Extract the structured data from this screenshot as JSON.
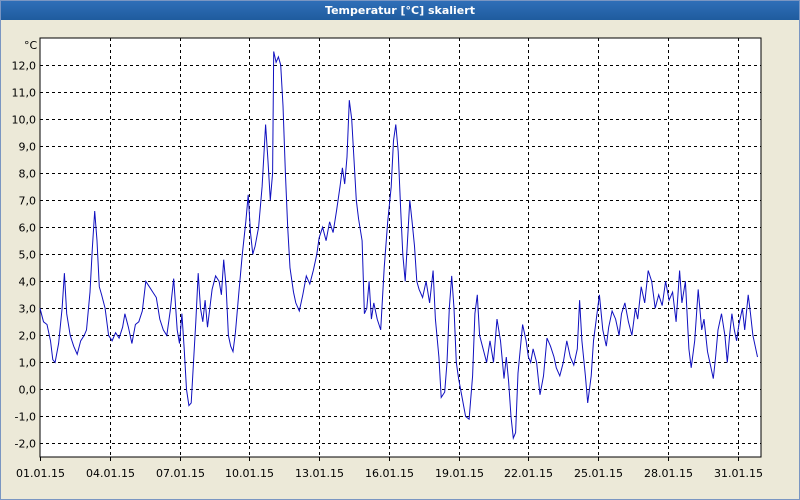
{
  "window": {
    "title": "Temperatur [°C] skaliert"
  },
  "colors": {
    "line": "#1010c0",
    "plot_bg": "#ffffff",
    "title_bar": "#1f5c9e",
    "window_bg": "#ece9d8"
  },
  "chart_data": {
    "type": "line",
    "title": "Temperatur [°C] skaliert",
    "ylabel": "°C",
    "xlabel": "",
    "ylim": [
      -2.5,
      13.0
    ],
    "xlim": [
      "2015-01-01",
      "2015-02-01"
    ],
    "grid": true,
    "y_ticks": [
      -2.0,
      -1.0,
      0.0,
      1.0,
      2.0,
      3.0,
      4.0,
      5.0,
      6.0,
      7.0,
      8.0,
      9.0,
      10.0,
      11.0,
      12.0
    ],
    "y_tick_labels": [
      "-2,0",
      "-1,0",
      "0,0",
      "1,0",
      "2,0",
      "3,0",
      "4,0",
      "5,0",
      "6,0",
      "7,0",
      "8,0",
      "9,0",
      "10,0",
      "11,0",
      "12,0"
    ],
    "x_tick_labels": [
      "01.01.15",
      "04.01.15",
      "07.01.15",
      "10.01.15",
      "13.01.15",
      "16.01.15",
      "19.01.15",
      "22.01.15",
      "25.01.15",
      "28.01.15",
      "31.01.15"
    ],
    "x_ticks_days": [
      0,
      3,
      6,
      9,
      12,
      15,
      18,
      21,
      24,
      27,
      30
    ],
    "series": [
      {
        "points": [
          [
            0.0,
            3.0
          ],
          [
            0.15,
            2.5
          ],
          [
            0.3,
            2.4
          ],
          [
            0.45,
            1.8
          ],
          [
            0.55,
            1.1
          ],
          [
            0.65,
            1.0
          ],
          [
            0.8,
            1.7
          ],
          [
            0.95,
            3.0
          ],
          [
            1.05,
            4.3
          ],
          [
            1.15,
            2.8
          ],
          [
            1.3,
            2.0
          ],
          [
            1.45,
            1.6
          ],
          [
            1.6,
            1.3
          ],
          [
            1.75,
            1.8
          ],
          [
            1.9,
            2.0
          ],
          [
            2.0,
            2.2
          ],
          [
            2.15,
            3.6
          ],
          [
            2.25,
            5.2
          ],
          [
            2.35,
            6.6
          ],
          [
            2.45,
            5.5
          ],
          [
            2.55,
            3.8
          ],
          [
            2.65,
            3.5
          ],
          [
            2.8,
            3.0
          ],
          [
            2.95,
            2.0
          ],
          [
            3.1,
            1.8
          ],
          [
            3.25,
            2.1
          ],
          [
            3.4,
            1.9
          ],
          [
            3.55,
            2.3
          ],
          [
            3.65,
            2.8
          ],
          [
            3.8,
            2.3
          ],
          [
            3.95,
            1.7
          ],
          [
            4.1,
            2.4
          ],
          [
            4.25,
            2.5
          ],
          [
            4.4,
            2.9
          ],
          [
            4.55,
            4.0
          ],
          [
            4.7,
            3.8
          ],
          [
            4.85,
            3.6
          ],
          [
            5.0,
            3.4
          ],
          [
            5.15,
            2.6
          ],
          [
            5.3,
            2.2
          ],
          [
            5.45,
            2.0
          ],
          [
            5.6,
            2.9
          ],
          [
            5.75,
            4.1
          ],
          [
            5.9,
            2.2
          ],
          [
            6.0,
            1.7
          ],
          [
            6.1,
            2.8
          ],
          [
            6.2,
            1.5
          ],
          [
            6.3,
            0.0
          ],
          [
            6.4,
            -0.6
          ],
          [
            6.5,
            -0.5
          ],
          [
            6.6,
            1.0
          ],
          [
            6.7,
            2.5
          ],
          [
            6.8,
            4.3
          ],
          [
            6.9,
            3.0
          ],
          [
            7.0,
            2.5
          ],
          [
            7.1,
            3.3
          ],
          [
            7.2,
            2.3
          ],
          [
            7.3,
            3.0
          ],
          [
            7.4,
            3.7
          ],
          [
            7.55,
            4.2
          ],
          [
            7.7,
            4.0
          ],
          [
            7.8,
            3.5
          ],
          [
            7.9,
            4.8
          ],
          [
            8.0,
            3.8
          ],
          [
            8.1,
            2.0
          ],
          [
            8.2,
            1.6
          ],
          [
            8.3,
            1.4
          ],
          [
            8.4,
            2.1
          ],
          [
            8.55,
            3.6
          ],
          [
            8.7,
            5.0
          ],
          [
            8.85,
            6.2
          ],
          [
            8.95,
            7.2
          ],
          [
            9.05,
            5.8
          ],
          [
            9.15,
            5.0
          ],
          [
            9.25,
            5.3
          ],
          [
            9.4,
            6.0
          ],
          [
            9.55,
            7.5
          ],
          [
            9.7,
            9.8
          ],
          [
            9.8,
            8.5
          ],
          [
            9.9,
            7.0
          ],
          [
            10.0,
            8.0
          ],
          [
            10.05,
            12.5
          ],
          [
            10.15,
            12.1
          ],
          [
            10.25,
            12.3
          ],
          [
            10.35,
            12.0
          ],
          [
            10.45,
            10.5
          ],
          [
            10.55,
            8.0
          ],
          [
            10.65,
            6.0
          ],
          [
            10.75,
            4.5
          ],
          [
            10.9,
            3.6
          ],
          [
            11.0,
            3.2
          ],
          [
            11.15,
            2.9
          ],
          [
            11.3,
            3.5
          ],
          [
            11.45,
            4.2
          ],
          [
            11.6,
            3.9
          ],
          [
            11.75,
            4.4
          ],
          [
            11.9,
            5.0
          ],
          [
            12.0,
            5.6
          ],
          [
            12.15,
            6.0
          ],
          [
            12.3,
            5.5
          ],
          [
            12.45,
            6.2
          ],
          [
            12.6,
            5.8
          ],
          [
            12.75,
            6.6
          ],
          [
            12.9,
            7.5
          ],
          [
            13.0,
            8.2
          ],
          [
            13.1,
            7.6
          ],
          [
            13.2,
            8.6
          ],
          [
            13.3,
            10.7
          ],
          [
            13.4,
            10.0
          ],
          [
            13.5,
            8.5
          ],
          [
            13.6,
            7.0
          ],
          [
            13.7,
            6.3
          ],
          [
            13.85,
            5.5
          ],
          [
            13.95,
            2.8
          ],
          [
            14.05,
            3.0
          ],
          [
            14.15,
            4.0
          ],
          [
            14.25,
            2.6
          ],
          [
            14.35,
            3.2
          ],
          [
            14.5,
            2.6
          ],
          [
            14.65,
            2.2
          ],
          [
            14.8,
            4.5
          ],
          [
            14.95,
            6.2
          ],
          [
            15.1,
            7.5
          ],
          [
            15.2,
            9.2
          ],
          [
            15.3,
            9.8
          ],
          [
            15.4,
            8.8
          ],
          [
            15.5,
            6.8
          ],
          [
            15.6,
            5.0
          ],
          [
            15.7,
            4.0
          ],
          [
            15.8,
            5.5
          ],
          [
            15.9,
            7.0
          ],
          [
            16.0,
            6.2
          ],
          [
            16.1,
            5.3
          ],
          [
            16.2,
            4.0
          ],
          [
            16.3,
            3.7
          ],
          [
            16.45,
            3.4
          ],
          [
            16.6,
            4.0
          ],
          [
            16.75,
            3.2
          ],
          [
            16.9,
            4.4
          ],
          [
            17.0,
            2.6
          ],
          [
            17.15,
            1.2
          ],
          [
            17.25,
            -0.3
          ],
          [
            17.4,
            -0.1
          ],
          [
            17.5,
            1.0
          ],
          [
            17.6,
            3.0
          ],
          [
            17.7,
            4.2
          ],
          [
            17.8,
            3.0
          ],
          [
            17.9,
            1.0
          ],
          [
            18.0,
            0.4
          ],
          [
            18.15,
            -0.3
          ],
          [
            18.3,
            -1.0
          ],
          [
            18.45,
            -1.1
          ],
          [
            18.6,
            0.5
          ],
          [
            18.7,
            2.8
          ],
          [
            18.8,
            3.5
          ],
          [
            18.9,
            2.0
          ],
          [
            19.05,
            1.5
          ],
          [
            19.2,
            1.0
          ],
          [
            19.35,
            1.8
          ],
          [
            19.5,
            1.0
          ],
          [
            19.65,
            2.6
          ],
          [
            19.8,
            1.8
          ],
          [
            19.95,
            0.4
          ],
          [
            20.05,
            1.2
          ],
          [
            20.15,
            0.3
          ],
          [
            20.25,
            -1.0
          ],
          [
            20.35,
            -1.8
          ],
          [
            20.45,
            -1.6
          ],
          [
            20.55,
            0.6
          ],
          [
            20.65,
            1.5
          ],
          [
            20.75,
            2.4
          ],
          [
            20.9,
            1.8
          ],
          [
            21.0,
            1.2
          ],
          [
            21.1,
            1.0
          ],
          [
            21.2,
            1.5
          ],
          [
            21.35,
            1.0
          ],
          [
            21.5,
            -0.2
          ],
          [
            21.65,
            0.5
          ],
          [
            21.8,
            1.9
          ],
          [
            21.95,
            1.6
          ],
          [
            22.1,
            1.2
          ],
          [
            22.2,
            0.8
          ],
          [
            22.35,
            0.5
          ],
          [
            22.5,
            1.0
          ],
          [
            22.65,
            1.8
          ],
          [
            22.8,
            1.2
          ],
          [
            22.95,
            0.9
          ],
          [
            23.1,
            1.5
          ],
          [
            23.2,
            3.3
          ],
          [
            23.3,
            1.8
          ],
          [
            23.45,
            0.5
          ],
          [
            23.55,
            -0.5
          ],
          [
            23.7,
            0.5
          ],
          [
            23.8,
            1.8
          ],
          [
            23.95,
            2.8
          ],
          [
            24.05,
            3.5
          ],
          [
            24.2,
            2.2
          ],
          [
            24.35,
            1.6
          ],
          [
            24.45,
            2.3
          ],
          [
            24.6,
            2.9
          ],
          [
            24.75,
            2.6
          ],
          [
            24.9,
            2.0
          ],
          [
            25.0,
            2.8
          ],
          [
            25.15,
            3.2
          ],
          [
            25.3,
            2.5
          ],
          [
            25.45,
            2.0
          ],
          [
            25.6,
            3.0
          ],
          [
            25.7,
            2.6
          ],
          [
            25.85,
            3.8
          ],
          [
            26.0,
            3.2
          ],
          [
            26.15,
            4.4
          ],
          [
            26.3,
            4.0
          ],
          [
            26.45,
            3.0
          ],
          [
            26.6,
            3.5
          ],
          [
            26.75,
            3.1
          ],
          [
            26.9,
            4.0
          ],
          [
            27.05,
            3.3
          ],
          [
            27.2,
            3.6
          ],
          [
            27.35,
            2.5
          ],
          [
            27.5,
            4.4
          ],
          [
            27.6,
            3.2
          ],
          [
            27.75,
            4.0
          ],
          [
            27.9,
            1.5
          ],
          [
            28.0,
            0.8
          ],
          [
            28.15,
            1.8
          ],
          [
            28.3,
            3.7
          ],
          [
            28.45,
            2.2
          ],
          [
            28.55,
            2.6
          ],
          [
            28.7,
            1.4
          ],
          [
            28.85,
            0.8
          ],
          [
            28.95,
            0.4
          ],
          [
            29.05,
            1.2
          ],
          [
            29.15,
            2.2
          ],
          [
            29.3,
            2.8
          ],
          [
            29.45,
            2.0
          ],
          [
            29.55,
            1.0
          ],
          [
            29.65,
            2.0
          ],
          [
            29.75,
            2.8
          ],
          [
            29.85,
            2.2
          ],
          [
            29.95,
            1.8
          ],
          [
            30.05,
            2.4
          ],
          [
            30.2,
            3.0
          ],
          [
            30.3,
            2.2
          ],
          [
            30.45,
            3.5
          ],
          [
            30.55,
            2.8
          ],
          [
            30.65,
            2.0
          ],
          [
            30.75,
            1.6
          ],
          [
            30.85,
            1.2
          ]
        ]
      }
    ]
  }
}
